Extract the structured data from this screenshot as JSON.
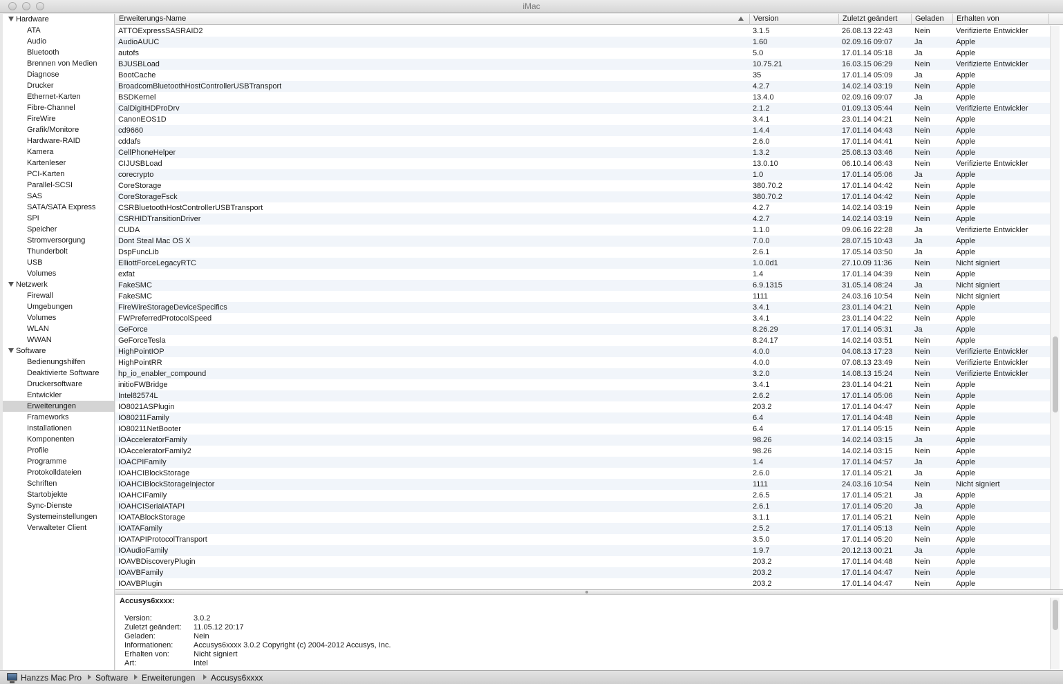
{
  "window": {
    "title": "iMac"
  },
  "sidebar": {
    "groups": [
      {
        "label": "Hardware",
        "items": [
          "ATA",
          "Audio",
          "Bluetooth",
          "Brennen von Medien",
          "Diagnose",
          "Drucker",
          "Ethernet-Karten",
          "Fibre-Channel",
          "FireWire",
          "Grafik/Monitore",
          "Hardware-RAID",
          "Kamera",
          "Kartenleser",
          "PCI-Karten",
          "Parallel-SCSI",
          "SAS",
          "SATA/SATA Express",
          "SPI",
          "Speicher",
          "Stromversorgung",
          "Thunderbolt",
          "USB",
          "Volumes"
        ]
      },
      {
        "label": "Netzwerk",
        "items": [
          "Firewall",
          "Umgebungen",
          "Volumes",
          "WLAN",
          "WWAN"
        ]
      },
      {
        "label": "Software",
        "items": [
          "Bedienungshilfen",
          "Deaktivierte Software",
          "Druckersoftware",
          "Entwickler",
          "Erweiterungen",
          "Frameworks",
          "Installationen",
          "Komponenten",
          "Profile",
          "Programme",
          "Protokolldateien",
          "Schriften",
          "Startobjekte",
          "Sync-Dienste",
          "Systemeinstellungen",
          "Verwalteter Client"
        ]
      }
    ],
    "selected": "Erweiterungen"
  },
  "table": {
    "columns": [
      "Erweiterungs-Name",
      "Version",
      "Zuletzt geändert",
      "Geladen",
      "Erhalten von"
    ],
    "sort_indicator": "ascending",
    "rows": [
      [
        "ATTOExpressSASRAID2",
        "3.1.5",
        "26.08.13 22:43",
        "Nein",
        "Verifizierte Entwickler"
      ],
      [
        "AudioAUUC",
        "1.60",
        "02.09.16 09:07",
        "Ja",
        "Apple"
      ],
      [
        "autofs",
        "5.0",
        "17.01.14 05:18",
        "Ja",
        "Apple"
      ],
      [
        "BJUSBLoad",
        "10.75.21",
        "16.03.15 06:29",
        "Nein",
        "Verifizierte Entwickler"
      ],
      [
        "BootCache",
        "35",
        "17.01.14 05:09",
        "Ja",
        "Apple"
      ],
      [
        "BroadcomBluetoothHostControllerUSBTransport",
        "4.2.7",
        "14.02.14 03:19",
        "Nein",
        "Apple"
      ],
      [
        "BSDKernel",
        "13.4.0",
        "02.09.16 09:07",
        "Ja",
        "Apple"
      ],
      [
        "CalDigitHDProDrv",
        "2.1.2",
        "01.09.13 05:44",
        "Nein",
        "Verifizierte Entwickler"
      ],
      [
        "CanonEOS1D",
        "3.4.1",
        "23.01.14 04:21",
        "Nein",
        "Apple"
      ],
      [
        "cd9660",
        "1.4.4",
        "17.01.14 04:43",
        "Nein",
        "Apple"
      ],
      [
        "cddafs",
        "2.6.0",
        "17.01.14 04:41",
        "Nein",
        "Apple"
      ],
      [
        "CellPhoneHelper",
        "1.3.2",
        "25.08.13 03:46",
        "Nein",
        "Apple"
      ],
      [
        "CIJUSBLoad",
        "13.0.10",
        "06.10.14 06:43",
        "Nein",
        "Verifizierte Entwickler"
      ],
      [
        "corecrypto",
        "1.0",
        "17.01.14 05:06",
        "Ja",
        "Apple"
      ],
      [
        "CoreStorage",
        "380.70.2",
        "17.01.14 04:42",
        "Nein",
        "Apple"
      ],
      [
        "CoreStorageFsck",
        "380.70.2",
        "17.01.14 04:42",
        "Nein",
        "Apple"
      ],
      [
        "CSRBluetoothHostControllerUSBTransport",
        "4.2.7",
        "14.02.14 03:19",
        "Nein",
        "Apple"
      ],
      [
        "CSRHIDTransitionDriver",
        "4.2.7",
        "14.02.14 03:19",
        "Nein",
        "Apple"
      ],
      [
        "CUDA",
        "1.1.0",
        "09.06.16 22:28",
        "Ja",
        "Verifizierte Entwickler"
      ],
      [
        "Dont Steal Mac OS X",
        "7.0.0",
        "28.07.15 10:43",
        "Ja",
        "Apple"
      ],
      [
        "DspFuncLib",
        "2.6.1",
        "17.05.14 03:50",
        "Ja",
        "Apple"
      ],
      [
        "ElliottForceLegacyRTC",
        "1.0.0d1",
        "27.10.09 11:36",
        "Nein",
        "Nicht signiert"
      ],
      [
        "exfat",
        "1.4",
        "17.01.14 04:39",
        "Nein",
        "Apple"
      ],
      [
        "FakeSMC",
        "6.9.1315",
        "31.05.14 08:24",
        "Ja",
        "Nicht signiert"
      ],
      [
        "FakeSMC",
        "1111",
        "24.03.16 10:54",
        "Nein",
        "Nicht signiert"
      ],
      [
        "FireWireStorageDeviceSpecifics",
        "3.4.1",
        "23.01.14 04:21",
        "Nein",
        "Apple"
      ],
      [
        "FWPreferredProtocolSpeed",
        "3.4.1",
        "23.01.14 04:22",
        "Nein",
        "Apple"
      ],
      [
        "GeForce",
        "8.26.29",
        "17.01.14 05:31",
        "Ja",
        "Apple"
      ],
      [
        "GeForceTesla",
        "8.24.17",
        "14.02.14 03:51",
        "Nein",
        "Apple"
      ],
      [
        "HighPointIOP",
        "4.0.0",
        "04.08.13 17:23",
        "Nein",
        "Verifizierte Entwickler"
      ],
      [
        "HighPointRR",
        "4.0.0",
        "07.08.13 23:49",
        "Nein",
        "Verifizierte Entwickler"
      ],
      [
        "hp_io_enabler_compound",
        "3.2.0",
        "14.08.13 15:24",
        "Nein",
        "Verifizierte Entwickler"
      ],
      [
        "initioFWBridge",
        "3.4.1",
        "23.01.14 04:21",
        "Nein",
        "Apple"
      ],
      [
        "Intel82574L",
        "2.6.2",
        "17.01.14 05:06",
        "Nein",
        "Apple"
      ],
      [
        "IO8021ASPlugin",
        "203.2",
        "17.01.14 04:47",
        "Nein",
        "Apple"
      ],
      [
        "IO80211Family",
        "6.4",
        "17.01.14 04:48",
        "Nein",
        "Apple"
      ],
      [
        "IO80211NetBooter",
        "6.4",
        "17.01.14 05:15",
        "Nein",
        "Apple"
      ],
      [
        "IOAcceleratorFamily",
        "98.26",
        "14.02.14 03:15",
        "Ja",
        "Apple"
      ],
      [
        "IOAcceleratorFamily2",
        "98.26",
        "14.02.14 03:15",
        "Nein",
        "Apple"
      ],
      [
        "IOACPIFamily",
        "1.4",
        "17.01.14 04:57",
        "Ja",
        "Apple"
      ],
      [
        "IOAHCIBlockStorage",
        "2.6.0",
        "17.01.14 05:21",
        "Ja",
        "Apple"
      ],
      [
        "IOAHCIBlockStorageInjector",
        "1111",
        "24.03.16 10:54",
        "Nein",
        "Nicht signiert"
      ],
      [
        "IOAHCIFamily",
        "2.6.5",
        "17.01.14 05:21",
        "Ja",
        "Apple"
      ],
      [
        "IOAHCISerialATAPI",
        "2.6.1",
        "17.01.14 05:20",
        "Ja",
        "Apple"
      ],
      [
        "IOATABlockStorage",
        "3.1.1",
        "17.01.14 05:21",
        "Nein",
        "Apple"
      ],
      [
        "IOATAFamily",
        "2.5.2",
        "17.01.14 05:13",
        "Nein",
        "Apple"
      ],
      [
        "IOATAPIProtocolTransport",
        "3.5.0",
        "17.01.14 05:20",
        "Nein",
        "Apple"
      ],
      [
        "IOAudioFamily",
        "1.9.7",
        "20.12.13 00:21",
        "Ja",
        "Apple"
      ],
      [
        "IOAVBDiscoveryPlugin",
        "203.2",
        "17.01.14 04:48",
        "Nein",
        "Apple"
      ],
      [
        "IOAVBFamily",
        "203.2",
        "17.01.14 04:47",
        "Nein",
        "Apple"
      ],
      [
        "IOAVBPlugin",
        "203.2",
        "17.01.14 04:47",
        "Nein",
        "Apple"
      ]
    ]
  },
  "detail": {
    "title": "Accusys6xxxx:",
    "fields": [
      {
        "label": "Version:",
        "value": "3.0.2"
      },
      {
        "label": "Zuletzt geändert:",
        "value": "11.05.12 20:17"
      },
      {
        "label": "Geladen:",
        "value": "Nein"
      },
      {
        "label": "Informationen:",
        "value": "Accusys6xxxx 3.0.2 Copyright (c) 2004-2012 Accusys, Inc."
      },
      {
        "label": "Erhalten von:",
        "value": "Nicht signiert"
      },
      {
        "label": "Art:",
        "value": "Intel"
      }
    ]
  },
  "pathbar": {
    "icon": "computer-icon",
    "crumbs": [
      "Hanzzs Mac Pro",
      "Software",
      "Erweiterungen",
      "Accusys6xxxx"
    ]
  }
}
